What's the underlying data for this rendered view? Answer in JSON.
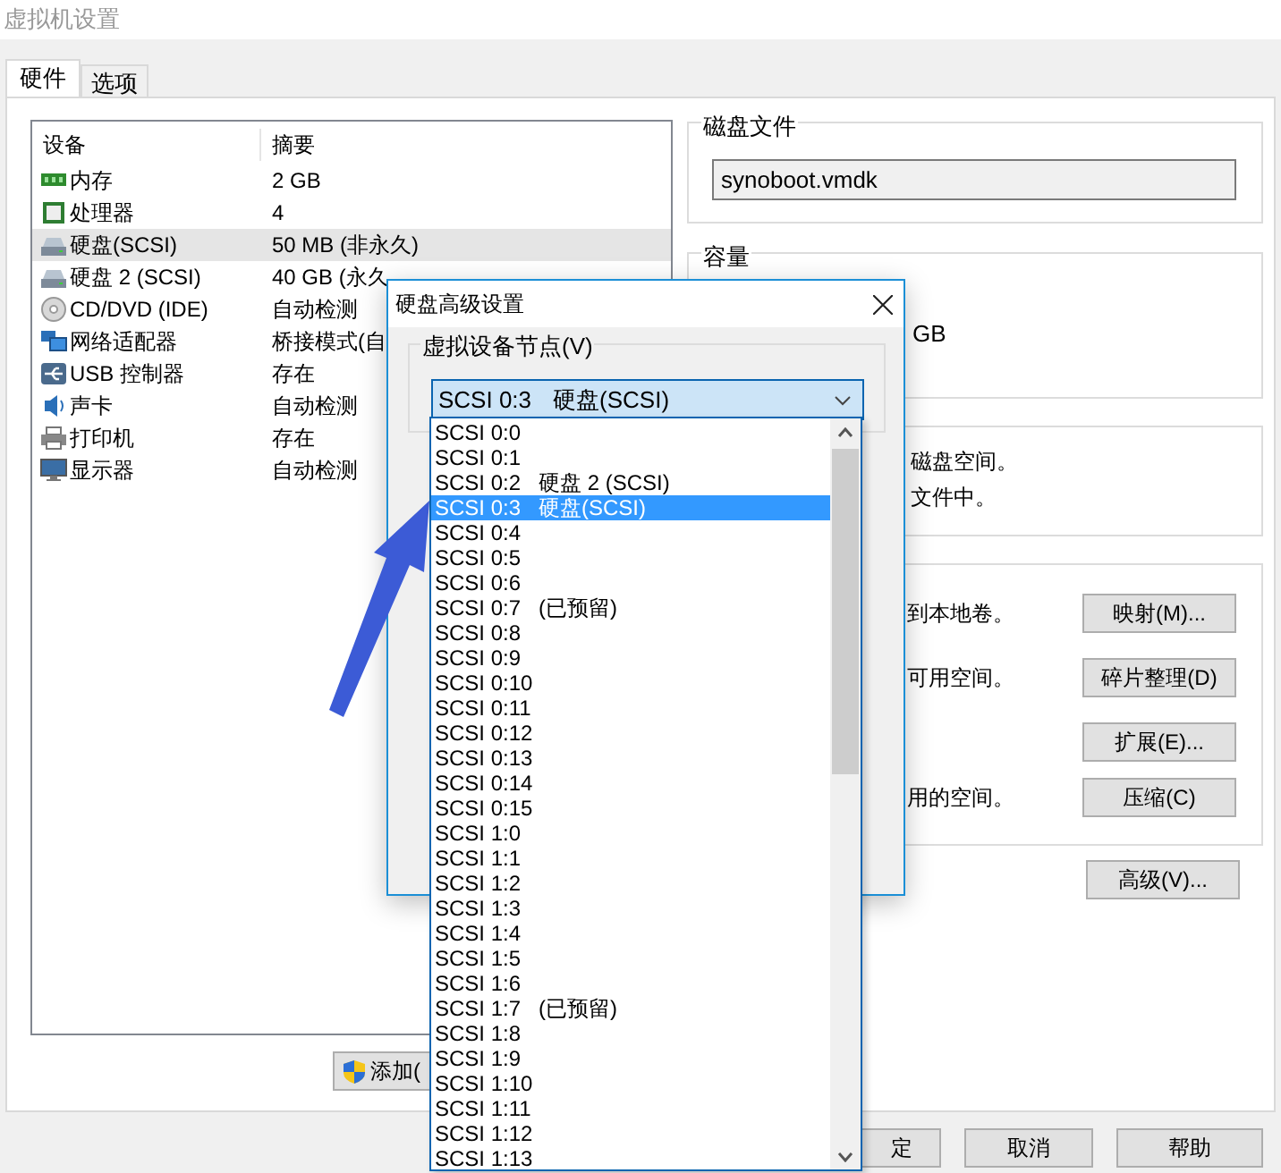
{
  "window": {
    "title": "虚拟机设置"
  },
  "tabs": [
    {
      "label": "硬件",
      "selected": true
    },
    {
      "label": "选项",
      "selected": false
    }
  ],
  "device_table": {
    "columns": [
      "设备",
      "摘要"
    ],
    "rows": [
      {
        "kind": "memory",
        "device": "内存",
        "summary": "2 GB",
        "selected": false
      },
      {
        "kind": "cpu",
        "device": "处理器",
        "summary": "4",
        "selected": false
      },
      {
        "kind": "disk",
        "device": "硬盘(SCSI)",
        "summary": "50 MB (非永久)",
        "selected": true
      },
      {
        "kind": "disk",
        "device": "硬盘 2 (SCSI)",
        "summary": "40 GB (永久",
        "selected": false
      },
      {
        "kind": "cd",
        "device": "CD/DVD (IDE)",
        "summary": "自动检测",
        "selected": false
      },
      {
        "kind": "network",
        "device": "网络适配器",
        "summary": "桥接模式(自",
        "selected": false
      },
      {
        "kind": "usb",
        "device": "USB 控制器",
        "summary": "存在",
        "selected": false
      },
      {
        "kind": "sound",
        "device": "声卡",
        "summary": "自动检测",
        "selected": false
      },
      {
        "kind": "printer",
        "device": "打印机",
        "summary": "存在",
        "selected": false
      },
      {
        "kind": "display",
        "device": "显示器",
        "summary": "自动检测",
        "selected": false
      }
    ]
  },
  "add_button": "添加(",
  "disk_file": {
    "label": "磁盘文件",
    "value": "synoboot.vmdk"
  },
  "capacity": {
    "label": "容量",
    "text": "GB"
  },
  "mode_group": {
    "lines": [
      "磁盘空间。",
      "文件中。"
    ]
  },
  "utilities": [
    {
      "text": "到本地卷。",
      "button": "映射(M)..."
    },
    {
      "text": "可用空间。",
      "button": "碎片整理(D)"
    },
    {
      "button": "扩展(E)..."
    },
    {
      "text": "用的空间。",
      "button": "压缩(C)"
    }
  ],
  "advanced_button": "高级(V)...",
  "footer_buttons": [
    "定",
    "取消",
    "帮助"
  ],
  "dialog": {
    "title": "硬盘高级设置",
    "group_label": "虚拟设备节点(V)",
    "combo_value": "SCSI 0:3",
    "combo_note": "硬盘(SCSI)"
  },
  "dropdown": [
    {
      "label": "SCSI 0:0",
      "selected": false
    },
    {
      "label": "SCSI 0:1",
      "selected": false
    },
    {
      "label": "SCSI 0:2",
      "note": "硬盘 2 (SCSI)",
      "selected": false
    },
    {
      "label": "SCSI 0:3",
      "note": "硬盘(SCSI)",
      "selected": true
    },
    {
      "label": "SCSI 0:4",
      "selected": false
    },
    {
      "label": "SCSI 0:5",
      "selected": false
    },
    {
      "label": "SCSI 0:6",
      "selected": false
    },
    {
      "label": "SCSI 0:7",
      "note": "(已预留)",
      "selected": false
    },
    {
      "label": "SCSI 0:8",
      "selected": false
    },
    {
      "label": "SCSI 0:9",
      "selected": false
    },
    {
      "label": "SCSI 0:10",
      "selected": false
    },
    {
      "label": "SCSI 0:11",
      "selected": false
    },
    {
      "label": "SCSI 0:12",
      "selected": false
    },
    {
      "label": "SCSI 0:13",
      "selected": false
    },
    {
      "label": "SCSI 0:14",
      "selected": false
    },
    {
      "label": "SCSI 0:15",
      "selected": false
    },
    {
      "label": "SCSI 1:0",
      "selected": false
    },
    {
      "label": "SCSI 1:1",
      "selected": false
    },
    {
      "label": "SCSI 1:2",
      "selected": false
    },
    {
      "label": "SCSI 1:3",
      "selected": false
    },
    {
      "label": "SCSI 1:4",
      "selected": false
    },
    {
      "label": "SCSI 1:5",
      "selected": false
    },
    {
      "label": "SCSI 1:6",
      "selected": false
    },
    {
      "label": "SCSI 1:7",
      "note": "(已预留)",
      "selected": false
    },
    {
      "label": "SCSI 1:8",
      "selected": false
    },
    {
      "label": "SCSI 1:9",
      "selected": false
    },
    {
      "label": "SCSI 1:10",
      "selected": false
    },
    {
      "label": "SCSI 1:11",
      "selected": false
    },
    {
      "label": "SCSI 1:12",
      "selected": false
    },
    {
      "label": "SCSI 1:13",
      "selected": false
    }
  ]
}
